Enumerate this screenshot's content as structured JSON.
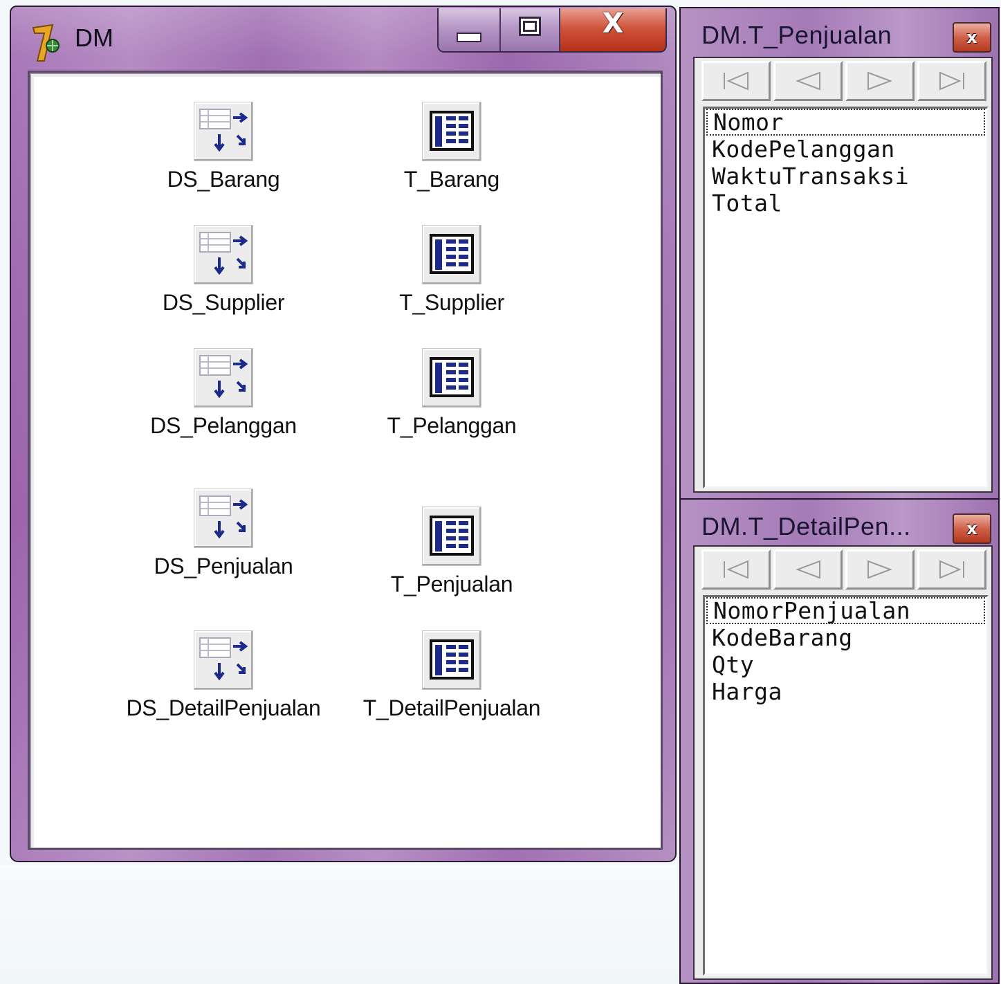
{
  "dm_window": {
    "title": "DM",
    "caption": {
      "close_glyph": "X"
    },
    "components": [
      {
        "datasource": "DS_Barang",
        "table": "T_Barang"
      },
      {
        "datasource": "DS_Supplier",
        "table": "T_Supplier"
      },
      {
        "datasource": "DS_Pelanggan",
        "table": "T_Pelanggan"
      },
      {
        "datasource": "DS_Penjualan",
        "table": "T_Penjualan"
      },
      {
        "datasource": "DS_DetailPenjualan",
        "table": "T_DetailPenjualan"
      }
    ]
  },
  "field_editor_penjualan": {
    "title": "DM.T_Penjualan",
    "fields": [
      "Nomor",
      "KodePelanggan",
      "WaktuTransaksi",
      "Total"
    ],
    "selected": "Nomor"
  },
  "field_editor_detail": {
    "title": "DM.T_DetailPen...",
    "fields": [
      "NomorPenjualan",
      "KodeBarang",
      "Qty",
      "Harga"
    ],
    "selected": "NomorPenjualan"
  },
  "icons": {
    "app": "delphi7-icon",
    "datasource": "datasource-icon",
    "table": "table-icon",
    "nav": [
      "first-record-icon",
      "prior-record-icon",
      "next-record-icon",
      "last-record-icon"
    ]
  },
  "colors": {
    "titlebar": "#a878b8",
    "close_button": "#c8472c",
    "icon_blue": "#1c2a8c"
  }
}
